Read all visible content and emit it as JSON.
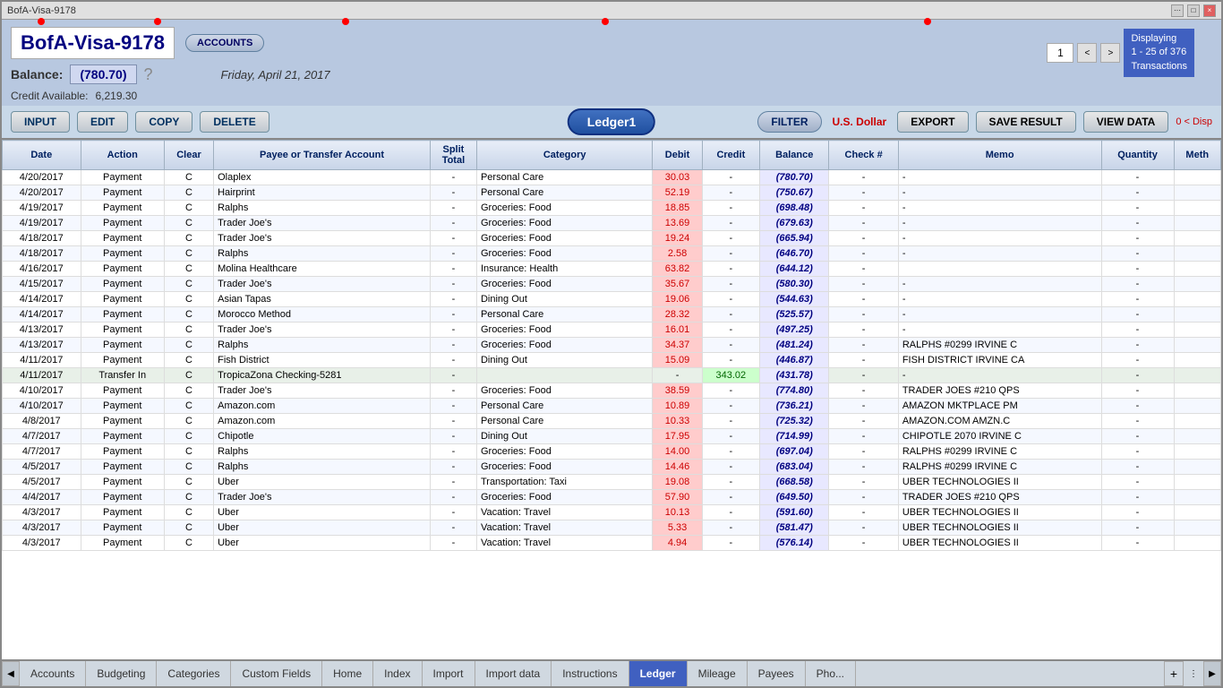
{
  "window": {
    "title": "BofA-Visa-9178"
  },
  "titlebar": {
    "dots": "···",
    "maximize": "□",
    "close": "×"
  },
  "header": {
    "account_name": "BofA-Visa-9178",
    "accounts_btn": "ACCOUNTS",
    "balance_label": "Balance:",
    "balance_value": "(780.70)",
    "question_mark": "?",
    "date": "Friday, April 21, 2017",
    "credit_label": "Credit Available:",
    "credit_value": "6,219.30"
  },
  "pagination": {
    "page": "1",
    "prev": "<",
    "next": ">",
    "display": "Displaying\n1 - 25 of 376\nTransactions"
  },
  "toolbar": {
    "input": "INPUT",
    "edit": "EDIT",
    "copy": "COPY",
    "delete": "DELETE",
    "ledger": "Ledger1",
    "filter": "FILTER",
    "currency": "U.S. Dollar",
    "export": "EXPORT",
    "save_result": "SAVE RESULT",
    "view_data": "VIEW DATA",
    "disp": "0 < Disp"
  },
  "table": {
    "headers": [
      "Date",
      "Action",
      "Clear",
      "Payee or Transfer Account",
      "Split Total",
      "Category",
      "Debit",
      "Credit",
      "Balance",
      "Check #",
      "Memo",
      "Quantity",
      "Meth"
    ],
    "rows": [
      [
        "4/20/2017",
        "Payment",
        "C",
        "Olaplex",
        "-",
        "Personal Care",
        "30.03",
        "-",
        "(780.70)",
        "-",
        "-",
        "-",
        ""
      ],
      [
        "4/20/2017",
        "Payment",
        "C",
        "Hairprint",
        "-",
        "Personal Care",
        "52.19",
        "-",
        "(750.67)",
        "-",
        "-",
        "-",
        ""
      ],
      [
        "4/19/2017",
        "Payment",
        "C",
        "Ralphs",
        "-",
        "Groceries: Food",
        "18.85",
        "-",
        "(698.48)",
        "-",
        "-",
        "-",
        ""
      ],
      [
        "4/19/2017",
        "Payment",
        "C",
        "Trader Joe's",
        "-",
        "Groceries: Food",
        "13.69",
        "-",
        "(679.63)",
        "-",
        "-",
        "-",
        ""
      ],
      [
        "4/18/2017",
        "Payment",
        "C",
        "Trader Joe's",
        "-",
        "Groceries: Food",
        "19.24",
        "-",
        "(665.94)",
        "-",
        "-",
        "-",
        ""
      ],
      [
        "4/18/2017",
        "Payment",
        "C",
        "Ralphs",
        "-",
        "Groceries: Food",
        "2.58",
        "-",
        "(646.70)",
        "-",
        "-",
        "-",
        ""
      ],
      [
        "4/16/2017",
        "Payment",
        "C",
        "Molina Healthcare",
        "-",
        "Insurance: Health",
        "63.82",
        "-",
        "(644.12)",
        "-",
        "",
        "-",
        ""
      ],
      [
        "4/15/2017",
        "Payment",
        "C",
        "Trader Joe's",
        "-",
        "Groceries: Food",
        "35.67",
        "-",
        "(580.30)",
        "-",
        "-",
        "-",
        ""
      ],
      [
        "4/14/2017",
        "Payment",
        "C",
        "Asian Tapas",
        "-",
        "Dining Out",
        "19.06",
        "-",
        "(544.63)",
        "-",
        "-",
        "-",
        ""
      ],
      [
        "4/14/2017",
        "Payment",
        "C",
        "Morocco Method",
        "-",
        "Personal Care",
        "28.32",
        "-",
        "(525.57)",
        "-",
        "-",
        "-",
        ""
      ],
      [
        "4/13/2017",
        "Payment",
        "C",
        "Trader Joe's",
        "-",
        "Groceries: Food",
        "16.01",
        "-",
        "(497.25)",
        "-",
        "-",
        "-",
        ""
      ],
      [
        "4/13/2017",
        "Payment",
        "C",
        "Ralphs",
        "-",
        "Groceries: Food",
        "34.37",
        "-",
        "(481.24)",
        "-",
        "RALPHS #0299 IRVINE C",
        "-",
        ""
      ],
      [
        "4/11/2017",
        "Payment",
        "C",
        "Fish District",
        "-",
        "Dining Out",
        "15.09",
        "-",
        "(446.87)",
        "-",
        "FISH DISTRICT IRVINE CA",
        "-",
        ""
      ],
      [
        "4/11/2017",
        "Transfer In",
        "C",
        "TropicaZona Checking-5281",
        "-",
        "",
        "-",
        "343.02",
        "(431.78)",
        "-",
        "-",
        "-",
        ""
      ],
      [
        "4/10/2017",
        "Payment",
        "C",
        "Trader Joe's",
        "-",
        "Groceries: Food",
        "38.59",
        "-",
        "(774.80)",
        "-",
        "TRADER JOES #210 QPS",
        "-",
        ""
      ],
      [
        "4/10/2017",
        "Payment",
        "C",
        "Amazon.com",
        "-",
        "Personal Care",
        "10.89",
        "-",
        "(736.21)",
        "-",
        "AMAZON MKTPLACE PM",
        "-",
        ""
      ],
      [
        "4/8/2017",
        "Payment",
        "C",
        "Amazon.com",
        "-",
        "Personal Care",
        "10.33",
        "-",
        "(725.32)",
        "-",
        "AMAZON.COM AMZN.C",
        "-",
        ""
      ],
      [
        "4/7/2017",
        "Payment",
        "C",
        "Chipotle",
        "-",
        "Dining Out",
        "17.95",
        "-",
        "(714.99)",
        "-",
        "CHIPOTLE 2070 IRVINE C",
        "-",
        ""
      ],
      [
        "4/7/2017",
        "Payment",
        "C",
        "Ralphs",
        "-",
        "Groceries: Food",
        "14.00",
        "-",
        "(697.04)",
        "-",
        "RALPHS #0299 IRVINE C",
        "-",
        ""
      ],
      [
        "4/5/2017",
        "Payment",
        "C",
        "Ralphs",
        "-",
        "Groceries: Food",
        "14.46",
        "-",
        "(683.04)",
        "-",
        "RALPHS #0299 IRVINE C",
        "-",
        ""
      ],
      [
        "4/5/2017",
        "Payment",
        "C",
        "Uber",
        "-",
        "Transportation: Taxi",
        "19.08",
        "-",
        "(668.58)",
        "-",
        "UBER TECHNOLOGIES II",
        "-",
        ""
      ],
      [
        "4/4/2017",
        "Payment",
        "C",
        "Trader Joe's",
        "-",
        "Groceries: Food",
        "57.90",
        "-",
        "(649.50)",
        "-",
        "TRADER JOES #210 QPS",
        "-",
        ""
      ],
      [
        "4/3/2017",
        "Payment",
        "C",
        "Uber",
        "-",
        "Vacation: Travel",
        "10.13",
        "-",
        "(591.60)",
        "-",
        "UBER TECHNOLOGIES II",
        "-",
        ""
      ],
      [
        "4/3/2017",
        "Payment",
        "C",
        "Uber",
        "-",
        "Vacation: Travel",
        "5.33",
        "-",
        "(581.47)",
        "-",
        "UBER TECHNOLOGIES II",
        "-",
        ""
      ],
      [
        "4/3/2017",
        "Payment",
        "C",
        "Uber",
        "-",
        "Vacation: Travel",
        "4.94",
        "-",
        "(576.14)",
        "-",
        "UBER TECHNOLOGIES II",
        "-",
        ""
      ]
    ]
  },
  "bottom_tabs": {
    "items": [
      {
        "label": "Accounts",
        "active": false
      },
      {
        "label": "Budgeting",
        "active": false
      },
      {
        "label": "Categories",
        "active": false
      },
      {
        "label": "Custom Fields",
        "active": false
      },
      {
        "label": "Home",
        "active": false
      },
      {
        "label": "Index",
        "active": false
      },
      {
        "label": "Import",
        "active": false
      },
      {
        "label": "Import data",
        "active": false
      },
      {
        "label": "Instructions",
        "active": false
      },
      {
        "label": "Ledger",
        "active": true
      },
      {
        "label": "Mileage",
        "active": false
      },
      {
        "label": "Payees",
        "active": false
      },
      {
        "label": "Pho...",
        "active": false
      }
    ]
  },
  "colors": {
    "debit_bg": "#ffcccc",
    "credit_bg": "#ccffcc",
    "balance_bg": "#e8e8ff",
    "active_tab_bg": "#4060c0",
    "header_bg": "#c0d0e0",
    "toolbar_bg": "#c8d8e8"
  }
}
